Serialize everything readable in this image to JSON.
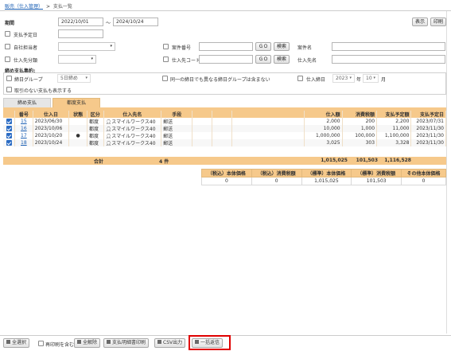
{
  "breadcrumb": {
    "parent": "販売（仕入管理）",
    "sep": ">",
    "current": "支払一覧"
  },
  "header_buttons": {
    "show": "表示",
    "print": "印刷"
  },
  "filters": {
    "period_label": "期間",
    "period_from": "2022/10/01",
    "period_sep": "～",
    "period_to": "2024/10/24",
    "scheduled_date_label": "支払予定日",
    "own_staff_label": "自社担当者",
    "case_no_label": "案件番号",
    "go_label": "ＧＯ",
    "search_label": "検索",
    "case_name_label": "案件名",
    "supplier_class_label": "仕入先分類",
    "supplier_code_label": "仕入先コード",
    "supplier_name_label": "仕入先名",
    "closing_title": "締め支払集約:",
    "closing_group_label": "締日グループ",
    "closing_group_value": "5日締め",
    "same_closing_label": "同一の締日でも異なる締日グループは含まない",
    "purchase_closing_label": "仕入締日",
    "year_value": "2023",
    "year_label": "年",
    "month_value": "10",
    "month_label": "月",
    "show_no_txn_label": "取引のない支払も表示する"
  },
  "tabs": [
    "締め支払",
    "都度支払"
  ],
  "table": {
    "headers": [
      "",
      "番号",
      "仕入日",
      "状態",
      "区分",
      "仕入先名",
      "手段",
      "",
      "",
      "",
      "仕入額",
      "消費税額",
      "支払予定額",
      "支払予定日"
    ],
    "rows": [
      {
        "no": "15",
        "date": "2023/06/30",
        "status": "",
        "kbn": "都度",
        "supplier": "スマイルワークス40",
        "method": "郵送",
        "amount": "2,000",
        "tax": "200",
        "total": "2,200",
        "due": "2023/07/31"
      },
      {
        "no": "16",
        "date": "2023/10/06",
        "status": "",
        "kbn": "都度",
        "supplier": "スマイルワークス40",
        "method": "郵送",
        "amount": "10,000",
        "tax": "1,000",
        "total": "11,000",
        "due": "2023/11/30"
      },
      {
        "no": "17",
        "date": "2023/10/20",
        "status": "●",
        "kbn": "都度",
        "supplier": "スマイルワークス40",
        "method": "郵送",
        "amount": "1,000,000",
        "tax": "100,000",
        "total": "1,100,000",
        "due": "2023/11/30"
      },
      {
        "no": "18",
        "date": "2023/10/24",
        "status": "",
        "kbn": "都度",
        "supplier": "スマイルワークス40",
        "method": "郵送",
        "amount": "3,025",
        "tax": "303",
        "total": "3,328",
        "due": "2023/11/30"
      }
    ],
    "total_label": "合計",
    "total_count": "4 件",
    "total_amount": "1,015,025",
    "total_tax": "101,503",
    "total_due": "1,116,528"
  },
  "summary": {
    "headers": [
      "（税込）本体価格",
      "（税込）消費税額",
      "（標準）本体価格",
      "（標準）消費税額",
      "その他本体価格"
    ],
    "values": [
      "0",
      "0",
      "1,015,025",
      "101,503",
      "0"
    ]
  },
  "footer": {
    "select_all": "全選択",
    "include_prev": "再印刷を含む",
    "deselect_all": "全解除",
    "print_statement": "支払明細書印刷",
    "csv": "CSV出力",
    "bulk_return": "一括返信"
  },
  "colors": {
    "accent": "#f6c98b",
    "link": "#1a5fb4",
    "highlight": "#e00000"
  }
}
